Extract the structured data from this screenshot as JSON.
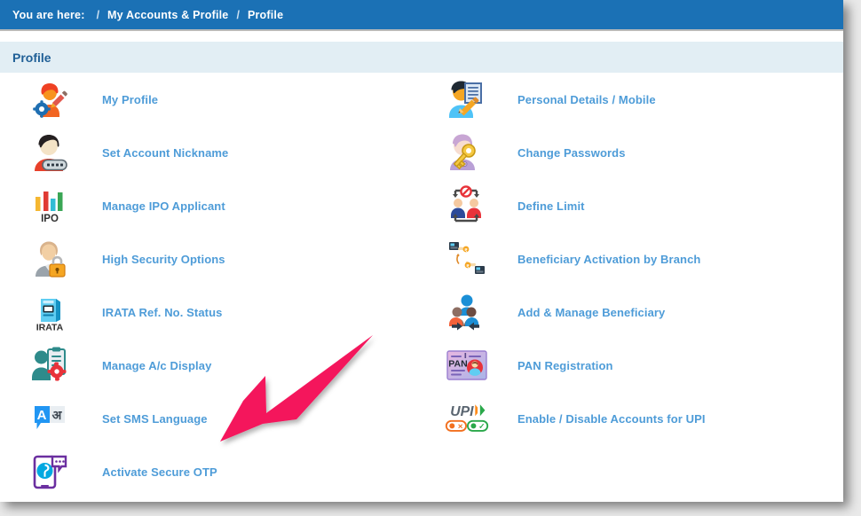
{
  "breadcrumb": {
    "label": "You are here:",
    "separator": "/",
    "items": [
      "My Accounts & Profile",
      "Profile"
    ]
  },
  "section": {
    "title": "Profile"
  },
  "colors": {
    "breadcrumb_bar": "#1b71b5",
    "section_band": "#e2eef4",
    "section_title": "#1f5f96",
    "link": "#4e9cd8",
    "page_background": "#ffffff",
    "annotation_arrow": "#f4145b"
  },
  "menu": {
    "left_column": [
      {
        "icon": "profile-user-gear-icon",
        "label": "My Profile"
      },
      {
        "icon": "account-nickname-icon",
        "label": "Set Account Nickname"
      },
      {
        "icon": "ipo-bars-icon",
        "label": "Manage IPO Applicant"
      },
      {
        "icon": "high-security-lock-icon",
        "label": "High Security Options"
      },
      {
        "icon": "irata-atm-icon",
        "label": "IRATA Ref. No. Status"
      },
      {
        "icon": "manage-account-display-icon",
        "label": "Manage A/c Display"
      },
      {
        "icon": "sms-language-icon",
        "label": "Set SMS Language"
      },
      {
        "icon": "secure-otp-icon",
        "label": "Activate Secure OTP"
      }
    ],
    "right_column": [
      {
        "icon": "personal-details-edit-icon",
        "label": "Personal Details / Mobile"
      },
      {
        "icon": "change-password-key-icon",
        "label": "Change Passwords"
      },
      {
        "icon": "define-limit-icon",
        "label": "Define Limit"
      },
      {
        "icon": "beneficiary-branch-icon",
        "label": "Beneficiary Activation by Branch"
      },
      {
        "icon": "add-manage-beneficiary-icon",
        "label": "Add & Manage Beneficiary"
      },
      {
        "icon": "pan-card-icon",
        "label": "PAN Registration"
      },
      {
        "icon": "upi-toggle-icon",
        "label": "Enable / Disable Accounts for UPI"
      }
    ]
  },
  "annotation": {
    "type": "arrow",
    "points_to": "Manage A/c Display",
    "color": "#f4145b"
  },
  "icon_glyph_text": {
    "ipo": "IPO",
    "irata": "IRATA",
    "pan": "PAN",
    "upi": "UPI",
    "sms_latin": "A",
    "sms_devanagari": "अ"
  }
}
